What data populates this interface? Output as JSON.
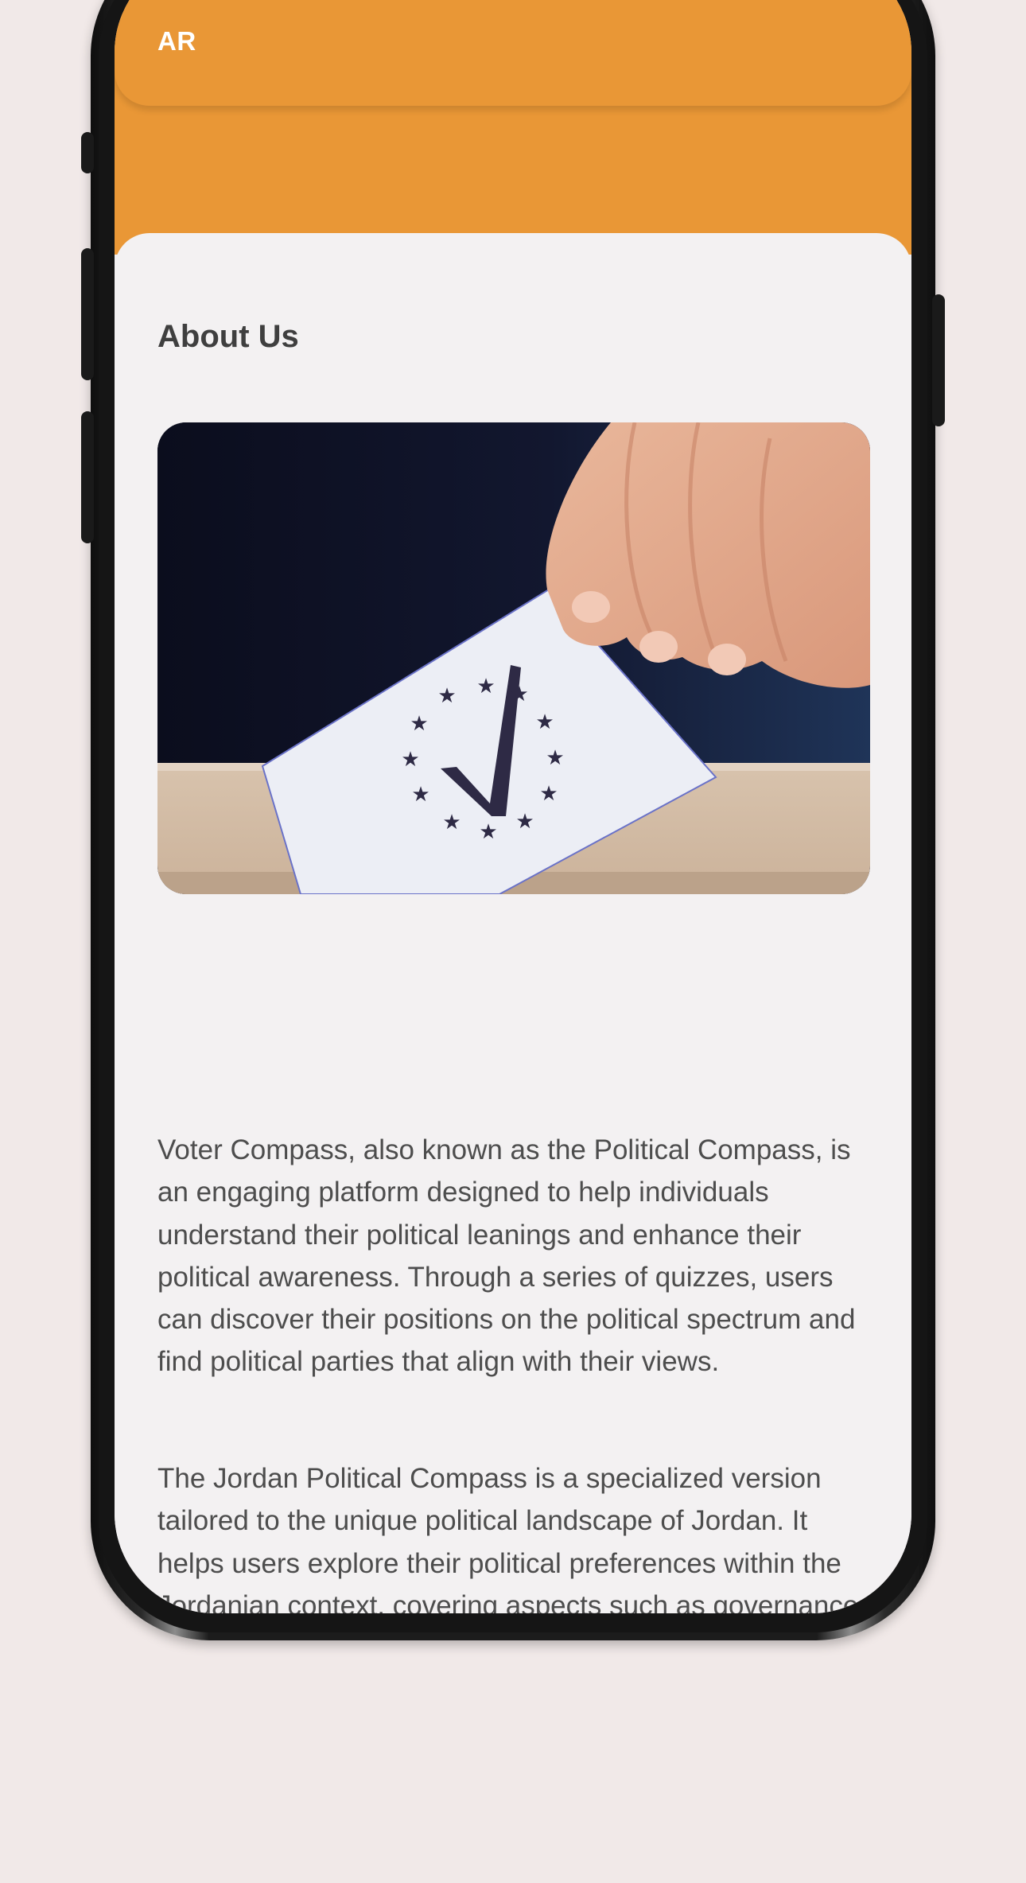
{
  "header": {
    "lang_toggle": "AR",
    "accent_color": "#e99736"
  },
  "about": {
    "title": "About Us",
    "image_icon": "ballot-box-vote-icon",
    "paragraphs": [
      "Voter Compass, also known as the Political Compass, is an engaging platform designed to help individuals understand their political leanings and enhance their political awareness. Through a series of quizzes, users can discover their positions on the political spectrum and find political parties that align with their views.",
      "The Jordan Political Compass is a specialized version tailored to the unique political landscape of Jordan. It helps users explore their political preferences within the Jordanian context, covering aspects such as governance, economic policies, and social issues......"
    ]
  }
}
